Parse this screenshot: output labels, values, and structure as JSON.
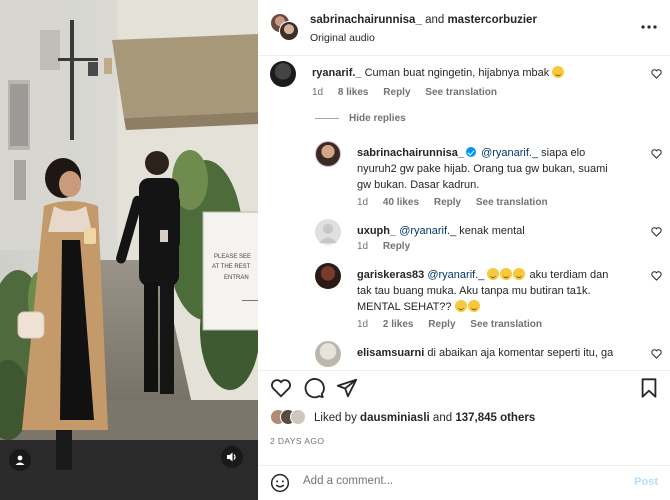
{
  "post": {
    "author_primary": "sabrinachairunnisa_",
    "author_joiner": "and",
    "author_secondary": "mastercorbuzier",
    "audio": "Original audio",
    "more_icon": "more-horizontal-icon"
  },
  "media": {
    "sign_lines": [
      "PLEASE SEE",
      "AT THE REST",
      "ENTRAN"
    ],
    "user_badge_icon": "user-icon",
    "sound_badge_icon": "speaker-icon"
  },
  "comments": [
    {
      "username": "ryanarif._",
      "text": "Cuman buat ngingetin, hijabnya mbak",
      "emoji_after": 1,
      "age": "1d",
      "likes": "8 likes",
      "reply": "Reply",
      "translate": "See translation"
    },
    {
      "is_reply": true,
      "username": "sabrinachairunnisa_",
      "verified": true,
      "mention": "@ryanarif._",
      "text": "siapa elo nyuruh2 gw pake hijab. Orang tua gw bukan, suami gw bukan. Dasar kadrun.",
      "age": "1d",
      "likes": "40 likes",
      "reply": "Reply",
      "translate": "See translation"
    },
    {
      "is_reply": true,
      "username": "uxuph_",
      "mention": "@ryanarif._",
      "text": "kenak mental",
      "age": "1d",
      "reply": "Reply"
    },
    {
      "is_reply": true,
      "username": "gariskeras83",
      "mention": "@ryanarif._",
      "text_a": "aku terdiam dan tak tau buang muka. Aku tanpa mu butiran ta1k. MENTAL SEHAT??",
      "age": "1d",
      "likes": "2 likes",
      "reply": "Reply",
      "translate": "See translation"
    },
    {
      "is_reply": true,
      "username": "elisamsuarni",
      "text": "di abaikan aja komentar seperti itu, ga"
    }
  ],
  "hide_replies": "Hide replies",
  "actions": {
    "like_icon": "heart-icon",
    "comment_icon": "comment-icon",
    "share_icon": "send-icon",
    "save_icon": "bookmark-icon"
  },
  "likes_summary": {
    "prefix": "Liked by",
    "user": "dausminiasli",
    "joiner": "and",
    "others": "137,845 others"
  },
  "date": "2 DAYS AGO",
  "composer": {
    "placeholder": "Add a comment...",
    "post_label": "Post"
  },
  "colors": {
    "link_blue": "#00376b",
    "verified_blue": "#0095f6",
    "post_disabled": "#b2dffc",
    "muted_text": "#737373"
  }
}
